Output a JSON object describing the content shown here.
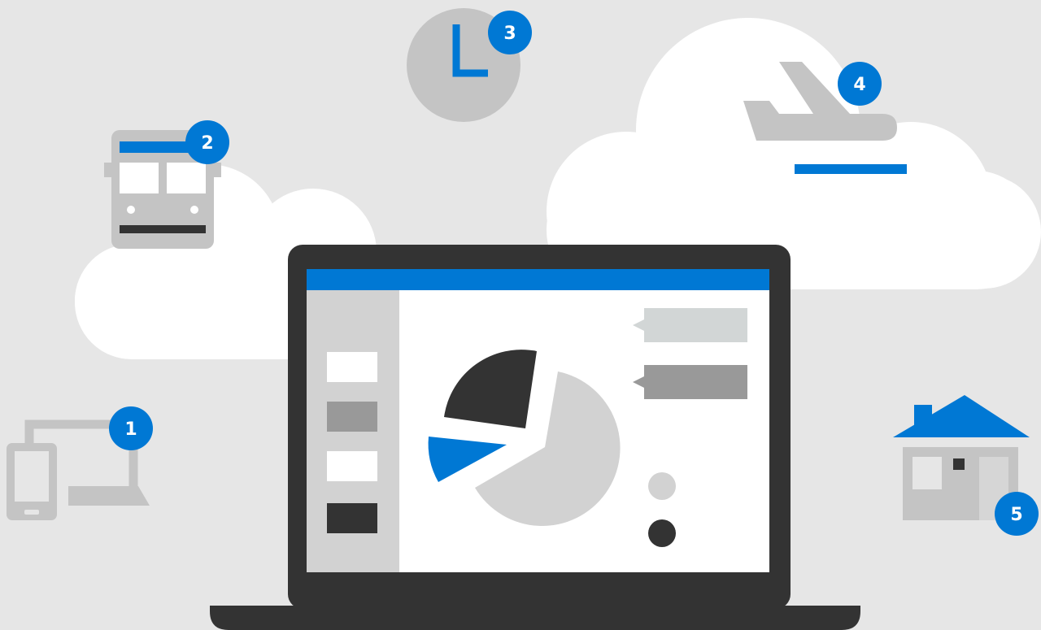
{
  "colors": {
    "background": "#e6e6e6",
    "accent_blue": "#0078d4",
    "cloud": "#ffffff",
    "icon_gray": "#c4c4c4",
    "dark": "#333333",
    "mid_gray": "#999999",
    "light_gray": "#d2d2d2"
  },
  "badges": {
    "devices": "1",
    "bus": "2",
    "clock": "3",
    "plane": "4",
    "house": "5"
  }
}
